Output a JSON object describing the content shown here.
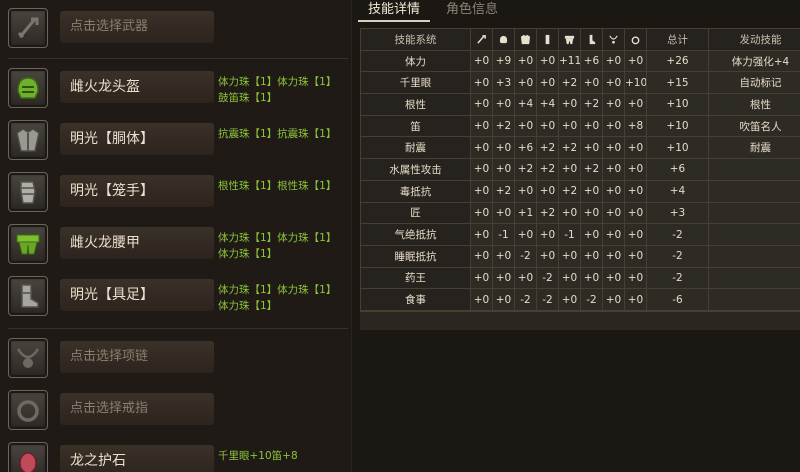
{
  "equipment": {
    "weapon": {
      "name": "点击选择武器",
      "jewels": []
    },
    "head": {
      "name": "雌火龙头盔",
      "jewels": [
        "体力珠【1】体力珠【1】",
        "鼓笛珠【1】"
      ]
    },
    "chest": {
      "name": "明光【胴体】",
      "jewels": [
        "抗震珠【1】抗震珠【1】"
      ]
    },
    "arms": {
      "name": "明光【笼手】",
      "jewels": [
        "根性珠【1】根性珠【1】"
      ]
    },
    "waist": {
      "name": "雌火龙腰甲",
      "jewels": [
        "体力珠【1】体力珠【1】",
        "体力珠【1】"
      ]
    },
    "legs": {
      "name": "明光【具足】",
      "jewels": [
        "体力珠【1】体力珠【1】",
        "体力珠【1】"
      ]
    },
    "necklace": {
      "name": "点击选择项链",
      "jewels": []
    },
    "ring": {
      "name": "点击选择戒指",
      "jewels": []
    },
    "charm": {
      "name": "龙之护石",
      "jewels": [
        "千里眼+10笛+8"
      ]
    }
  },
  "tabs": {
    "skill": "技能详情",
    "character": "角色信息"
  },
  "table": {
    "headers": {
      "name": "技能系统",
      "total": "总计",
      "active": "发动技能"
    },
    "col_icons": [
      "weapon-icon",
      "helmet-icon",
      "chest-icon",
      "arms-icon",
      "waist-icon",
      "legs-icon",
      "necklace-icon",
      "ring-icon"
    ],
    "rows": [
      {
        "name": "体力",
        "vals": [
          "+0",
          "+9",
          "+0",
          "+0",
          "+11",
          "+6",
          "+0",
          "+0"
        ],
        "total": "+26",
        "active": "体力强化+4"
      },
      {
        "name": "千里眼",
        "vals": [
          "+0",
          "+3",
          "+0",
          "+0",
          "+2",
          "+0",
          "+0",
          "+10"
        ],
        "total": "+15",
        "active": "自动标记"
      },
      {
        "name": "根性",
        "vals": [
          "+0",
          "+0",
          "+4",
          "+4",
          "+0",
          "+2",
          "+0",
          "+0"
        ],
        "total": "+10",
        "active": "根性"
      },
      {
        "name": "笛",
        "vals": [
          "+0",
          "+2",
          "+0",
          "+0",
          "+0",
          "+0",
          "+0",
          "+8"
        ],
        "total": "+10",
        "active": "吹笛名人"
      },
      {
        "name": "耐震",
        "vals": [
          "+0",
          "+0",
          "+6",
          "+2",
          "+2",
          "+0",
          "+0",
          "+0"
        ],
        "total": "+10",
        "active": "耐震"
      },
      {
        "name": "水属性攻击",
        "vals": [
          "+0",
          "+0",
          "+2",
          "+2",
          "+0",
          "+2",
          "+0",
          "+0"
        ],
        "total": "+6",
        "active": ""
      },
      {
        "name": "毒抵抗",
        "vals": [
          "+0",
          "+2",
          "+0",
          "+0",
          "+2",
          "+0",
          "+0",
          "+0"
        ],
        "total": "+4",
        "active": ""
      },
      {
        "name": "匠",
        "vals": [
          "+0",
          "+0",
          "+1",
          "+2",
          "+0",
          "+0",
          "+0",
          "+0"
        ],
        "total": "+3",
        "active": ""
      },
      {
        "name": "气绝抵抗",
        "vals": [
          "+0",
          "-1",
          "+0",
          "+0",
          "-1",
          "+0",
          "+0",
          "+0"
        ],
        "total": "-2",
        "active": ""
      },
      {
        "name": "睡眠抵抗",
        "vals": [
          "+0",
          "+0",
          "-2",
          "+0",
          "+0",
          "+0",
          "+0",
          "+0"
        ],
        "total": "-2",
        "active": ""
      },
      {
        "name": "药王",
        "vals": [
          "+0",
          "+0",
          "+0",
          "-2",
          "+0",
          "+0",
          "+0",
          "+0"
        ],
        "total": "-2",
        "active": ""
      },
      {
        "name": "食事",
        "vals": [
          "+0",
          "+0",
          "-2",
          "-2",
          "+0",
          "-2",
          "+0",
          "+0"
        ],
        "total": "-6",
        "active": ""
      }
    ]
  }
}
